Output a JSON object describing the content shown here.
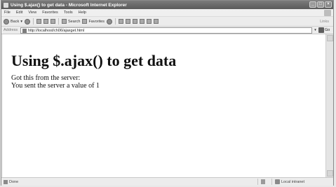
{
  "window": {
    "title": "Using $.ajax() to get data - Microsoft Internet Explorer"
  },
  "menu": [
    "File",
    "Edit",
    "View",
    "Favorites",
    "Tools",
    "Help"
  ],
  "toolbar": {
    "back_label": "Back",
    "search_label": "Search",
    "favorites_label": "Favorites",
    "links_label": "Links"
  },
  "address": {
    "label": "Address",
    "url": "http://localhost/ch06/ajaxget.html",
    "go_label": "Go"
  },
  "page": {
    "heading": "Using $.ajax() to get data",
    "line1": "Got this from the server:",
    "line2": "You sent the server a value of 1"
  },
  "status": {
    "text": "Done",
    "zone": "Local intranet"
  }
}
